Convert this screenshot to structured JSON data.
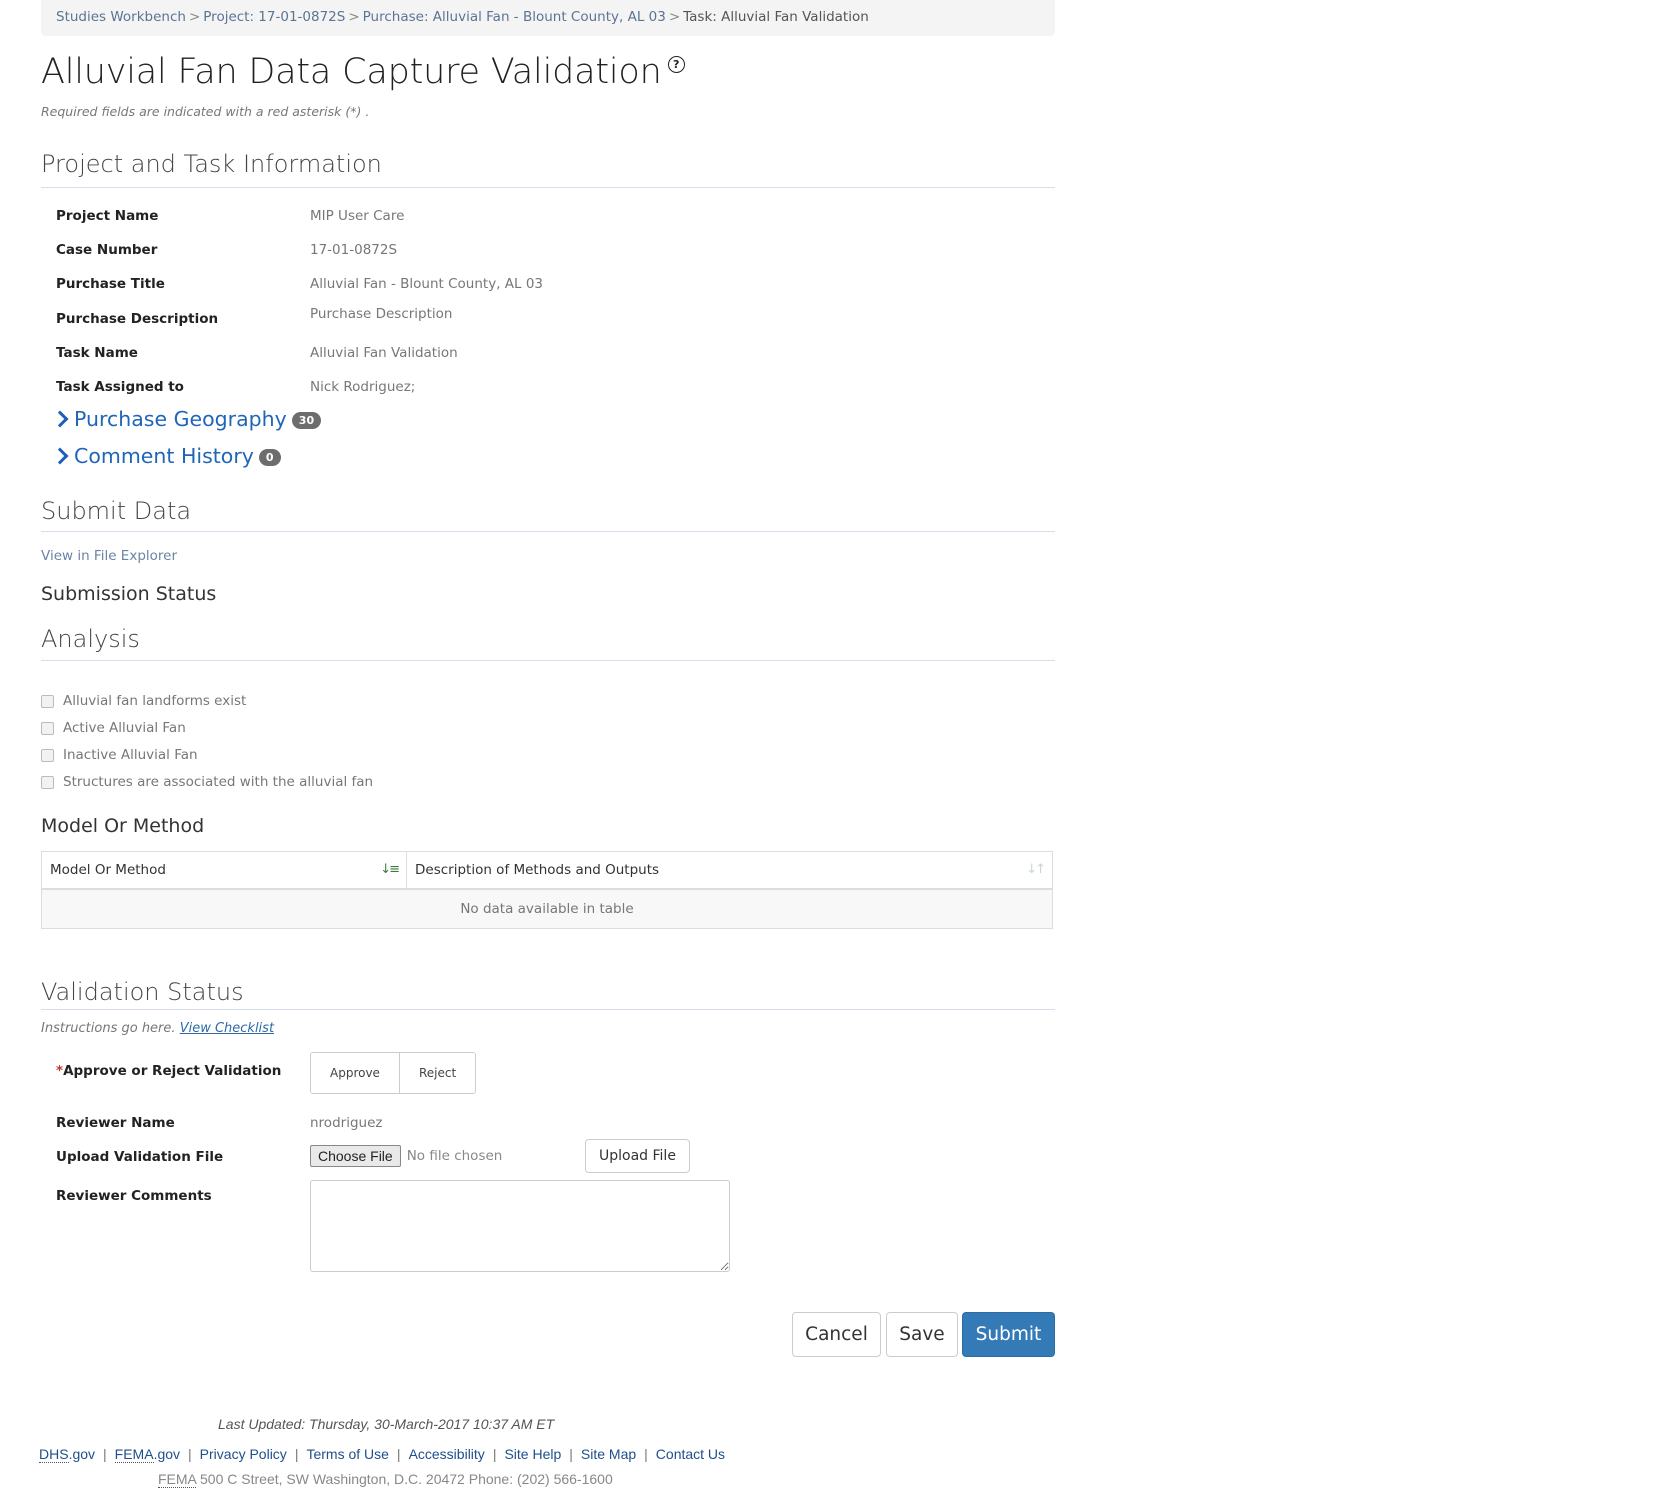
{
  "breadcrumb": {
    "items": [
      "Studies Workbench",
      "Project: 17-01-0872S",
      "Purchase: Alluvial Fan - Blount County, AL 03"
    ],
    "current": "Task: Alluvial Fan Validation",
    "separator": ">"
  },
  "page": {
    "title": "Alluvial Fan Data Capture Validation",
    "help_icon": "?",
    "required_note": "Required fields are indicated with a red asterisk (*) ."
  },
  "project_info": {
    "heading": "Project and Task Information",
    "fields": [
      {
        "label": "Project Name",
        "value": "MIP User Care"
      },
      {
        "label": "Case Number",
        "value": "17-01-0872S"
      },
      {
        "label": "Purchase Title",
        "value": "Alluvial Fan - Blount County, AL 03"
      },
      {
        "label": "Purchase Description",
        "value": "Purchase Description"
      },
      {
        "label": "Task Name",
        "value": "Alluvial Fan Validation"
      },
      {
        "label": "Task Assigned to",
        "value": "Nick Rodriguez;"
      }
    ],
    "toggles": [
      {
        "label": "Purchase Geography",
        "count": "30"
      },
      {
        "label": "Comment History",
        "count": "0"
      }
    ]
  },
  "submit_data": {
    "heading": "Submit Data",
    "file_explorer_link": "View in File Explorer",
    "submission_status_heading": "Submission Status"
  },
  "analysis": {
    "heading": "Analysis",
    "checkboxes": [
      {
        "label": "Alluvial fan landforms exist",
        "checked": false
      },
      {
        "label": "Active Alluvial Fan",
        "checked": false
      },
      {
        "label": "Inactive Alluvial Fan",
        "checked": false
      },
      {
        "label": "Structures are associated with the alluvial fan",
        "checked": false
      }
    ]
  },
  "model_table": {
    "heading": "Model Or Method",
    "columns": [
      "Model Or Method",
      "Description of Methods and Outputs"
    ],
    "empty_message": "No data available in table",
    "sort_icons": [
      "sort-ascending-icon",
      "sort-both-icon"
    ]
  },
  "validation": {
    "heading": "Validation Status",
    "instructions": "Instructions go here.",
    "checklist_link": "View Checklist",
    "approve_label": "Approve or Reject Validation",
    "required_mark": "*",
    "approve_button": "Approve",
    "reject_button": "Reject",
    "reviewer_name_label": "Reviewer Name",
    "reviewer_name": "nrodriguez",
    "upload_label": "Upload Validation File",
    "choose_file": "Choose File",
    "no_file": "No file chosen",
    "upload_button": "Upload File",
    "comments_label": "Reviewer Comments",
    "comments_value": ""
  },
  "actions": {
    "cancel": "Cancel",
    "save": "Save",
    "submit": "Submit"
  },
  "footer": {
    "last_updated": "Last Updated: Thursday, 30-March-2017 10:37 AM ET",
    "links": [
      {
        "abbr": "DHS",
        "rest": ".gov"
      },
      {
        "abbr": "FEMA",
        "rest": ".gov"
      },
      {
        "abbr": "",
        "rest": "Privacy Policy"
      },
      {
        "abbr": "",
        "rest": "Terms of Use"
      },
      {
        "abbr": "",
        "rest": "Accessibility"
      },
      {
        "abbr": "",
        "rest": "Site Help"
      },
      {
        "abbr": "",
        "rest": "Site Map"
      },
      {
        "abbr": "",
        "rest": "Contact Us"
      }
    ],
    "address_abbr": "FEMA",
    "address": " 500 C Street, SW Washington, D.C. 20472 Phone: (202) 566-1600"
  },
  "colors": {
    "link_blue": "#1f66b8",
    "primary_button": "#337ab7",
    "badge_gray": "#6d6d6d",
    "required_red": "#c0392b"
  }
}
